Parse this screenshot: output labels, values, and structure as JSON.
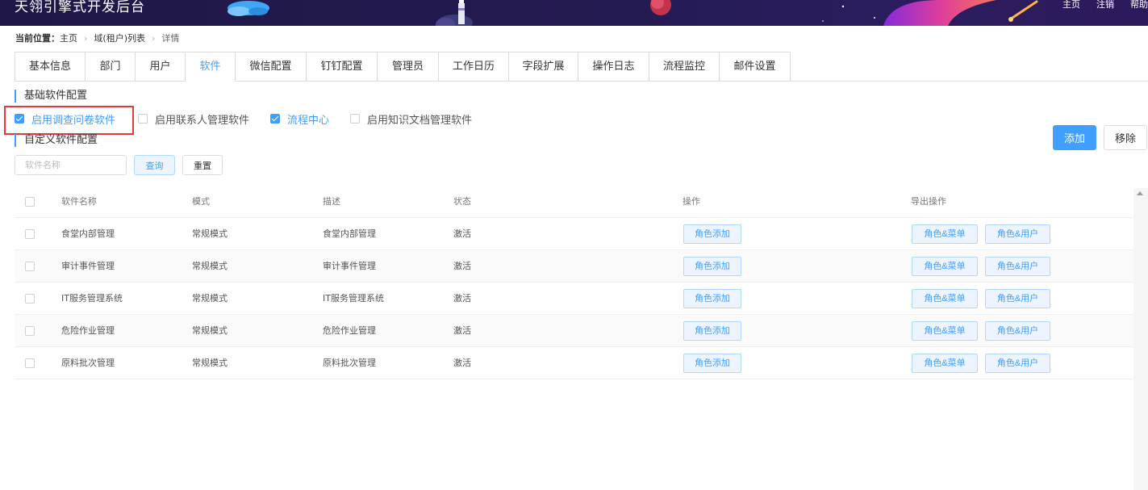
{
  "header": {
    "title": "天翎引擎式开发后台",
    "nav": [
      "主页",
      "注销",
      "帮助"
    ]
  },
  "breadcrumb": {
    "lead": "当前位置：",
    "items": [
      "主页",
      "域(租户)列表",
      "详情"
    ]
  },
  "tabs": {
    "items": [
      "基本信息",
      "部门",
      "用户",
      "软件",
      "微信配置",
      "钉钉配置",
      "管理员",
      "工作日历",
      "字段扩展",
      "操作日志",
      "流程监控",
      "邮件设置"
    ],
    "active": "软件"
  },
  "basic_section": {
    "title": "基础软件配置",
    "options": [
      {
        "label": "启用调查问卷软件",
        "checked": true
      },
      {
        "label": "启用联系人管理软件",
        "checked": false
      },
      {
        "label": "流程中心",
        "checked": true
      },
      {
        "label": "启用知识文档管理软件",
        "checked": false
      }
    ]
  },
  "custom_section": {
    "title": "自定义软件配置",
    "add_label": "添加",
    "remove_label": "移除",
    "search_placeholder": "软件名称",
    "query_label": "查询",
    "reset_label": "重置"
  },
  "table": {
    "columns": [
      "软件名称",
      "模式",
      "描述",
      "状态",
      "操作",
      "导出操作"
    ],
    "rows": [
      {
        "name": "食堂内部管理",
        "mode": "常规模式",
        "desc": "食堂内部管理",
        "state": "激活"
      },
      {
        "name": "审计事件管理",
        "mode": "常规模式",
        "desc": "审计事件管理",
        "state": "激活"
      },
      {
        "name": "IT服务管理系统",
        "mode": "常规模式",
        "desc": "IT服务管理系统",
        "state": "激活"
      },
      {
        "name": "危险作业管理",
        "mode": "常规模式",
        "desc": "危险作业管理",
        "state": "激活"
      },
      {
        "name": "原料批次管理",
        "mode": "常规模式",
        "desc": "原料批次管理",
        "state": "激活"
      }
    ],
    "op_add_label": "角色添加",
    "export_menu_label": "角色&菜单",
    "export_user_label": "角色&用户"
  },
  "colors": {
    "accent": "#409eff",
    "header_bg": "#231a50",
    "highlight": "#e53935"
  }
}
